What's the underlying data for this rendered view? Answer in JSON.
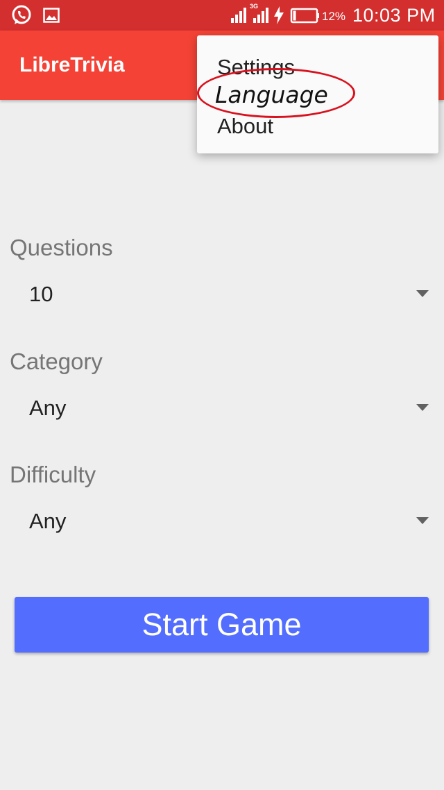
{
  "status_bar": {
    "left_icons": [
      "whatsapp-icon",
      "image-icon"
    ],
    "right_icons": [
      "signal-icon",
      "signal-3g-icon",
      "charging-icon",
      "battery-icon"
    ],
    "network_label": "3G",
    "battery_percent": "12%",
    "time": "10:03 PM"
  },
  "app_bar": {
    "title": "LibreTrivia"
  },
  "form": {
    "questions": {
      "label": "Questions",
      "value": "10"
    },
    "category": {
      "label": "Category",
      "value": "Any"
    },
    "difficulty": {
      "label": "Difficulty",
      "value": "Any"
    },
    "start_button": "Start Game"
  },
  "overflow_menu": {
    "items": [
      "Settings",
      "Language",
      "About"
    ]
  },
  "colors": {
    "status_bar": "#d32f2f",
    "app_bar": "#f44336",
    "background": "#eeeeee",
    "button": "#536dfe",
    "annotation": "#d8121f"
  }
}
